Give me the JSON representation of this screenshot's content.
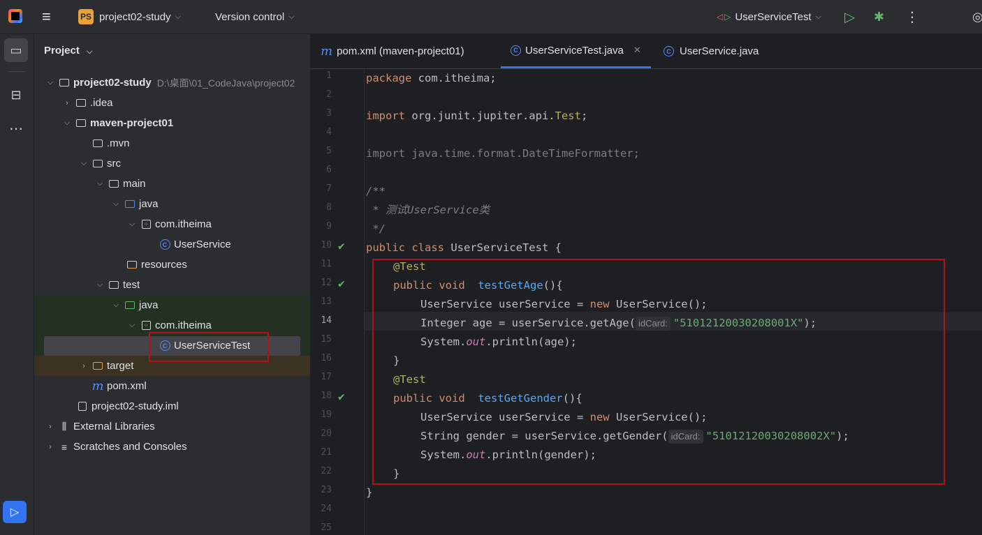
{
  "titlebar": {
    "project_badge": "PS",
    "project_name": "project02-study",
    "vcs_label": "Version control",
    "run_config": "UserServiceTest"
  },
  "project_panel": {
    "header": "Project",
    "tree": [
      {
        "label": "project02-study",
        "path": "D:\\桌面\\01_CodeJava\\project02"
      },
      {
        "label": ".idea"
      },
      {
        "label": "maven-project01"
      },
      {
        "label": ".mvn"
      },
      {
        "label": "src"
      },
      {
        "label": "main"
      },
      {
        "label": "java"
      },
      {
        "label": "com.itheima"
      },
      {
        "label": "UserService"
      },
      {
        "label": "resources"
      },
      {
        "label": "test"
      },
      {
        "label": "java"
      },
      {
        "label": "com.itheima"
      },
      {
        "label": "UserServiceTest"
      },
      {
        "label": "target"
      },
      {
        "label": "pom.xml"
      },
      {
        "label": "project02-study.iml"
      },
      {
        "label": "External Libraries"
      },
      {
        "label": "Scratches and Consoles"
      }
    ]
  },
  "tabs": [
    {
      "label": "pom.xml (maven-project01)"
    },
    {
      "label": "UserServiceTest.java"
    },
    {
      "label": "UserService.java"
    }
  ],
  "code": {
    "l1_kw": "package",
    "l1_rest": " com.itheima;",
    "l3_kw": "import",
    "l3_rest": " org.junit.jupiter.api.",
    "l3_ann": "Test",
    "l3_end": ";",
    "l5": "import java.time.format.DateTimeFormatter;",
    "l7": "/**",
    "l8": " * 测试UserService类",
    "l9": " */",
    "l10_kw": "public class",
    "l10_rest": " UserServiceTest {",
    "l11": "@Test",
    "l12_kw": "public void",
    "l12_fn": "testGetAge",
    "l12_end": "(){",
    "l13_a": "UserService userService = ",
    "l13_kw": "new",
    "l13_b": " UserService();",
    "l14_a": "Integer age = userService.getAge(",
    "l14_hint": "idCard:",
    "l14_str": "\"51012120030208001X\"",
    "l14_end": ");",
    "l15_a": "System.",
    "l15_static": "out",
    "l15_b": ".println(age);",
    "l16": "}",
    "l17": "@Test",
    "l18_kw": "public void",
    "l18_fn": "testGetGender",
    "l18_end": "(){",
    "l19_a": "UserService userService = ",
    "l19_kw": "new",
    "l19_b": " UserService();",
    "l20_a": "String gender = userService.getGender(",
    "l20_hint": "idCard:",
    "l20_str": "\"51012120030208002X\"",
    "l20_end": ");",
    "l21_a": "System.",
    "l21_static": "out",
    "l21_b": ".println(gender);",
    "l22": "}",
    "l23": "}"
  },
  "line_numbers": [
    "1",
    "2",
    "3",
    "4",
    "5",
    "6",
    "7",
    "8",
    "9",
    "10",
    "11",
    "12",
    "13",
    "14",
    "15",
    "16",
    "17",
    "18",
    "19",
    "20",
    "21",
    "22",
    "23",
    "24",
    "25"
  ]
}
